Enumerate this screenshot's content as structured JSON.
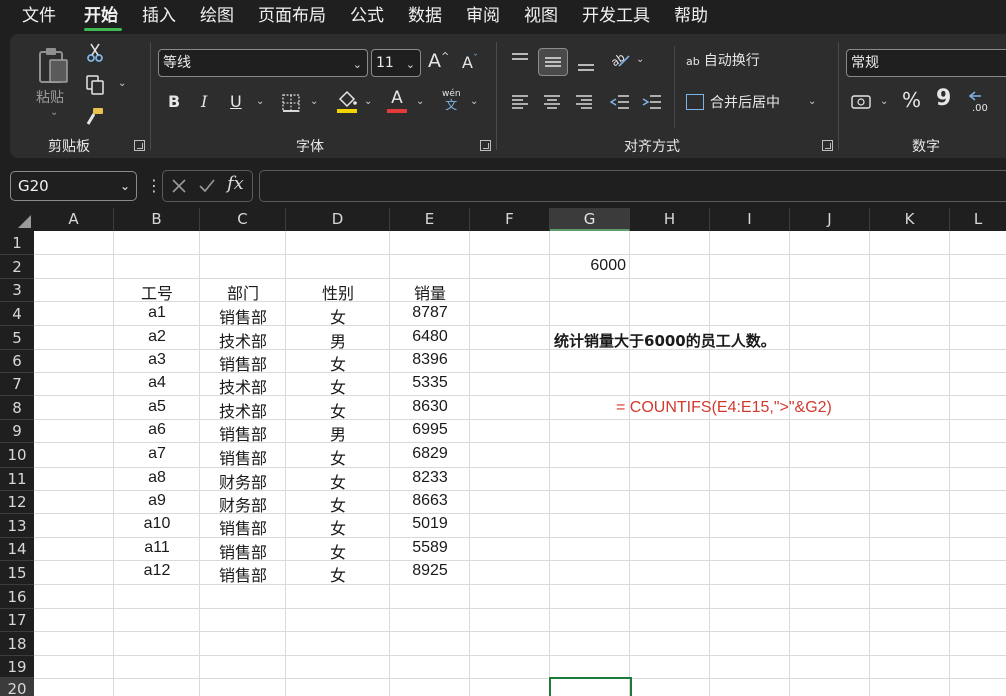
{
  "menu": {
    "items": [
      "文件",
      "开始",
      "插入",
      "绘图",
      "页面布局",
      "公式",
      "数据",
      "审阅",
      "视图",
      "开发工具",
      "帮助"
    ],
    "active": "开始"
  },
  "ribbon": {
    "clipboard": {
      "paste_label": "粘贴",
      "group_label": "剪贴板"
    },
    "font": {
      "font_name": "等线",
      "font_size": "11",
      "wen_top": "wén",
      "wen_bottom": "文",
      "group_label": "字体",
      "bold": "B",
      "italic": "I",
      "underline": "U",
      "grow": "A",
      "shrink": "A",
      "font_color_letter": "A"
    },
    "alignment": {
      "wrap_text": "自动换行",
      "merge_center": "合并后居中",
      "group_label": "对齐方式",
      "wrap_icon_text": "ab"
    },
    "number": {
      "format": "常规",
      "percent": "%",
      "comma": "9",
      "group_label": "数字"
    },
    "colors": {
      "highlight": "#f4d400",
      "font_color": "#e23b3b"
    }
  },
  "formula_bar": {
    "name_box": "G20",
    "fx": "fx",
    "formula": ""
  },
  "grid": {
    "columns": [
      "A",
      "B",
      "C",
      "D",
      "E",
      "F",
      "G",
      "H",
      "I",
      "J",
      "K",
      "L"
    ],
    "selected_column": "G",
    "rows": [
      "1",
      "2",
      "3",
      "4",
      "5",
      "6",
      "7",
      "8",
      "9",
      "10",
      "11",
      "12",
      "13",
      "14",
      "15",
      "16",
      "17",
      "18",
      "19",
      "20"
    ],
    "selected_row": "20",
    "table": {
      "headers": [
        "工号",
        "部门",
        "性别",
        "销量"
      ],
      "rows": [
        [
          "a1",
          "销售部",
          "女",
          "8787"
        ],
        [
          "a2",
          "技术部",
          "男",
          "6480"
        ],
        [
          "a3",
          "销售部",
          "女",
          "8396"
        ],
        [
          "a4",
          "技术部",
          "女",
          "5335"
        ],
        [
          "a5",
          "技术部",
          "女",
          "8630"
        ],
        [
          "a6",
          "销售部",
          "男",
          "6995"
        ],
        [
          "a7",
          "销售部",
          "女",
          "6829"
        ],
        [
          "a8",
          "财务部",
          "女",
          "8233"
        ],
        [
          "a9",
          "财务部",
          "女",
          "8663"
        ],
        [
          "a10",
          "销售部",
          "女",
          "5019"
        ],
        [
          "a11",
          "销售部",
          "女",
          "5589"
        ],
        [
          "a12",
          "销售部",
          "女",
          "8925"
        ]
      ]
    },
    "g2_value": "6000",
    "task_text": "统计销量大于6000的员工人数。",
    "formula_text": "=  COUNTIFS(E4:E15,\">\"&G2)",
    "active_cell": "G20"
  }
}
